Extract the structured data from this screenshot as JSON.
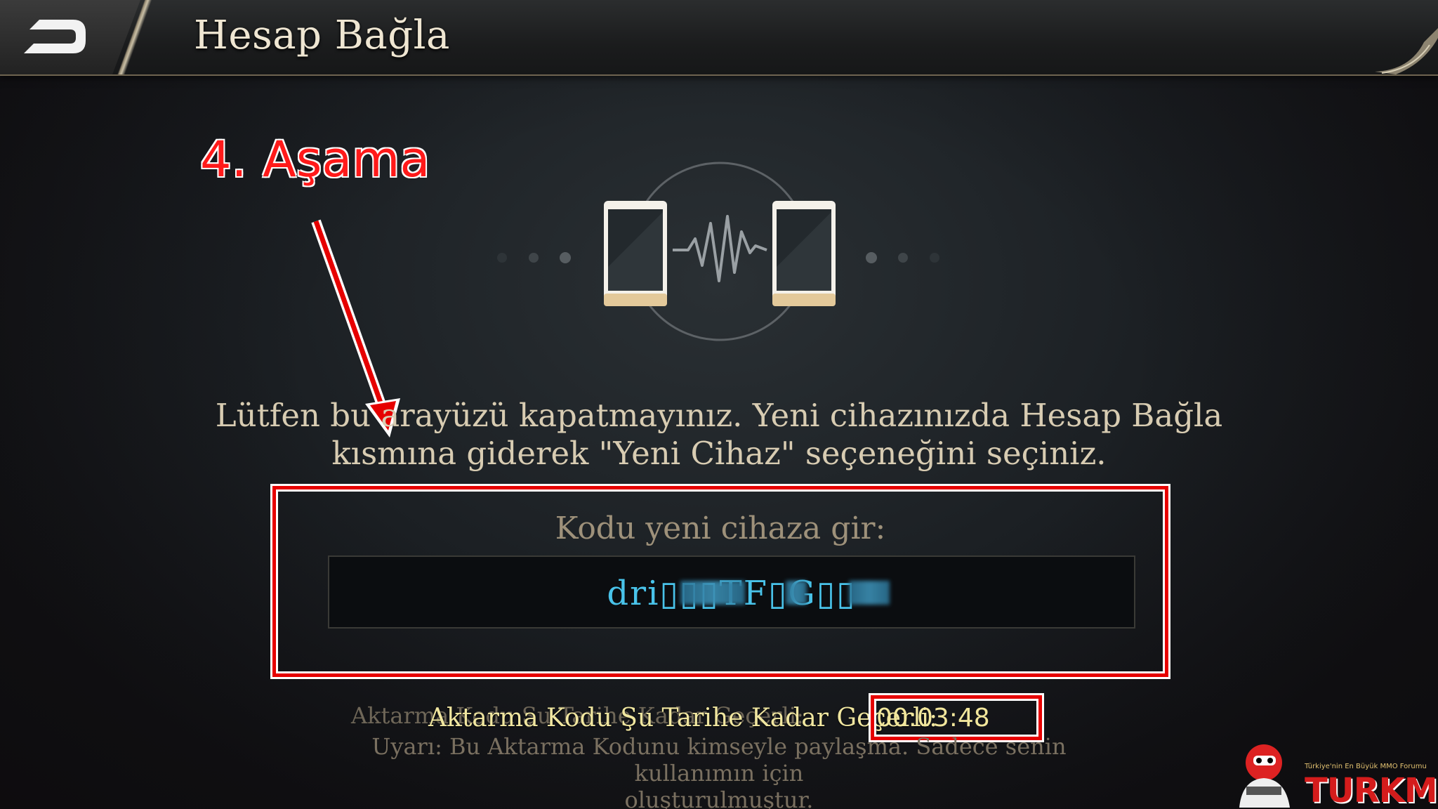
{
  "header": {
    "title": "Hesap Bağla",
    "back_icon": "back-arrow-icon"
  },
  "annotation": {
    "step_label": "4. Aşama",
    "color": "#ff1a1a"
  },
  "illustration": {
    "icon": "phone-transfer-icon"
  },
  "info": {
    "line1": "Lütfen bu arayüzü kapatmayınız. Yeni cihazınızda Hesap Bağla",
    "line2": "kısmına giderek \"Yeni Cihaz\" seçeneğini seçiniz."
  },
  "code": {
    "prompt": "Kodu yeni cihaza gir:",
    "value_visible": "dri▯▯▯TF▯G▯▯"
  },
  "expiry": {
    "label_ghost": "Aktarma Kodu Şu Tarihe Kadar Geçerli:",
    "label": "Aktarma Kodu Şu Tarihe Kadar Geçerli:",
    "timer": "00:03:48"
  },
  "warning": {
    "line1": "Uyarı: Bu Aktarma Kodunu kimseyle paylaşma. Sadece senin kullanımın için",
    "line2": "oluşturulmuştur."
  },
  "watermark": {
    "tagline": "Türkiye'nin En Büyük MMO Forumu",
    "logo": "TURKMMO",
    "mascot_icon": "mascot-icon"
  }
}
